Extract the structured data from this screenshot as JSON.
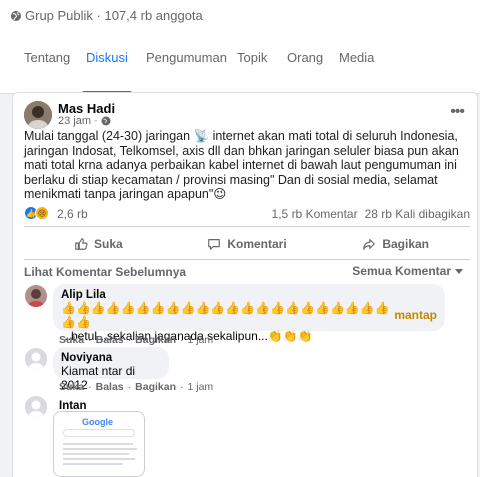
{
  "group": {
    "meta": "Grup Publik · 107,4 rb anggota",
    "tabs": [
      "Tentang",
      "Diskusi",
      "Pengumuman",
      "Topik",
      "Orang",
      "Media"
    ],
    "active_tab": "Diskusi"
  },
  "post": {
    "author": "Mas Hadi",
    "time": "23 jam ·",
    "text": "Mulai tanggal (24-30) jaringan 📡 internet akan mati total di seluruh Indonesia,  jaringan Indosat, Telkomsel, axis dll dan bhkan jaringan seluler biasa pun akan mati total krna adanya perbaikan kabel internet di bawah laut    pengumuman ini berlaku di stiap kecamatan / provinsi masing\" Dan di sosial media,  selamat menikmati tanpa jaringan apapun\"😉",
    "reaction_count": "2,6 rb",
    "comments_count": "1,5 rb Komentar",
    "shares_count": "28 rb Kali dibagikan",
    "actions": {
      "like": "Suka",
      "comment": "Komentari",
      "share": "Bagikan"
    }
  },
  "comments_header": {
    "previous": "Lihat Komentar Sebelumnya",
    "filter": "Semua Komentar"
  },
  "comments": [
    {
      "name": "Alip Lila",
      "emoji_line": "👍👍👍👍👍👍👍👍👍👍👍👍👍👍👍👍👍👍👍👍👍👍👍👍",
      "mantap": "mantap",
      "text": "...betul...sekalian jaganada sekalipun...",
      "hands": "👏👏👏",
      "meta": {
        "like": "Suka",
        "reply": "Balas",
        "share": "Bagikan",
        "time": "1 jam"
      }
    },
    {
      "name": "Noviyana",
      "text": "Kiamat ntar di 2012",
      "meta": {
        "like": "Suka",
        "reply": "Balas",
        "share": "Bagikan",
        "time": "1 jam"
      }
    },
    {
      "name": "Intan",
      "image_label": "Google"
    }
  ],
  "colors": {
    "accent": "#1877f2",
    "muted": "#65676b",
    "bubble": "#f0f2f5"
  }
}
